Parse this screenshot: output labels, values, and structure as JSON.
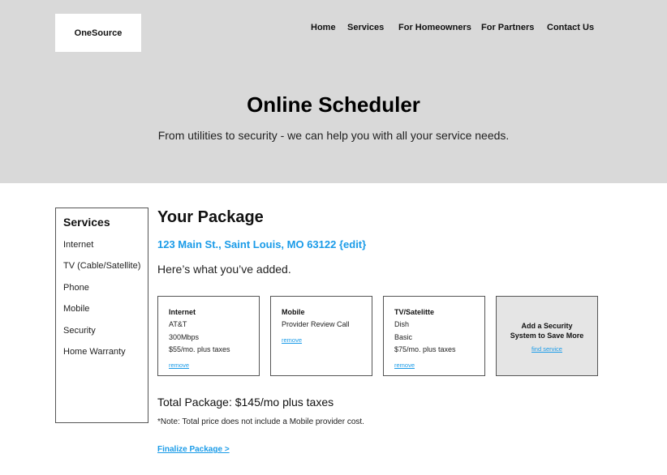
{
  "header": {
    "logo": "OneSource",
    "nav": [
      {
        "label": "Home"
      },
      {
        "label": "Services"
      },
      {
        "label": "For Homeowners"
      },
      {
        "label": "For Partners"
      },
      {
        "label": "Contact Us"
      }
    ]
  },
  "hero": {
    "title": "Online Scheduler",
    "subtitle": "From utilities to security - we can help you with all your service needs."
  },
  "sidebar": {
    "title": "Services",
    "items": [
      {
        "label": "Internet"
      },
      {
        "label": "TV (Cable/Satellite)"
      },
      {
        "label": "Phone"
      },
      {
        "label": "Mobile"
      },
      {
        "label": "Security"
      },
      {
        "label": "Home Warranty"
      }
    ]
  },
  "package": {
    "title": "Your Package",
    "address": "123 Main St., Saint Louis, MO 63122 {edit}",
    "intro": "Here’s what you’ve added.",
    "cards": [
      {
        "title": "Internet",
        "lines": [
          "AT&T",
          "300Mbps",
          "$55/mo. plus taxes"
        ],
        "action": "remove"
      },
      {
        "title": "Mobile",
        "lines": [
          "Provider Review Call"
        ],
        "action": "remove"
      },
      {
        "title": "TV/Satelitte",
        "lines": [
          "Dish",
          "Basic",
          "$75/mo. plus taxes"
        ],
        "action": "remove"
      }
    ],
    "promo": {
      "title_line1": "Add a Security",
      "title_line2": "System to Save More",
      "action": "find service"
    },
    "total": "Total Package: $145/mo plus taxes",
    "note": "*Note: Total price does not include a Mobile provider cost.",
    "finalize": "Finalize Package >"
  },
  "colors": {
    "hero_bg": "#d9d9d9",
    "link": "#1a9be8",
    "promo_bg": "#e5e5e5",
    "border": "#555555"
  }
}
